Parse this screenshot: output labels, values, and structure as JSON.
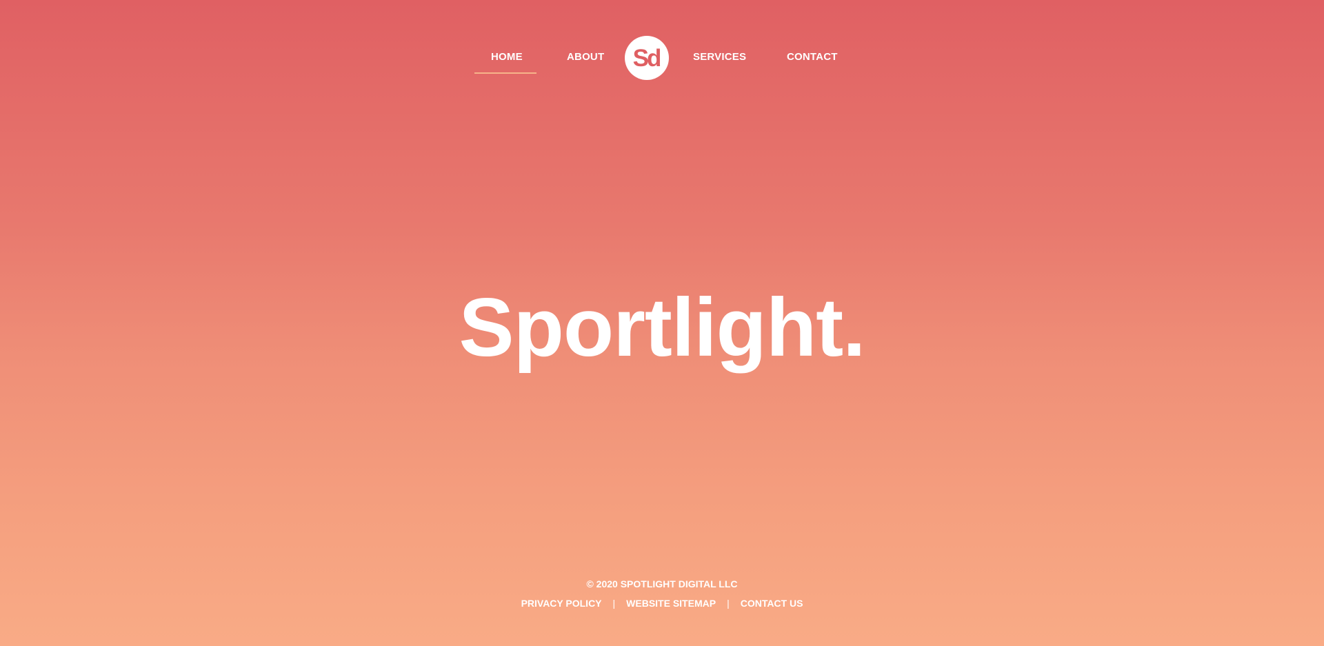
{
  "nav": {
    "home": "HOME",
    "about": "ABOUT",
    "services": "SERVICES",
    "contact": "CONTACT",
    "logo_text": "Sd"
  },
  "hero": {
    "title": "Sportlight."
  },
  "footer": {
    "copyright": "© 2020 SPOTLIGHT DIGITAL LLC",
    "links": [
      "PRIVACY POLICY",
      "WEBSITE SITEMAP",
      "CONTACT US"
    ],
    "separator": "|"
  },
  "colors": {
    "gradient_top": "#e06063",
    "gradient_bottom": "#f9ab86",
    "logo_text": "#df5f62",
    "active_underline": "#f7b48a",
    "text": "#ffffff"
  }
}
